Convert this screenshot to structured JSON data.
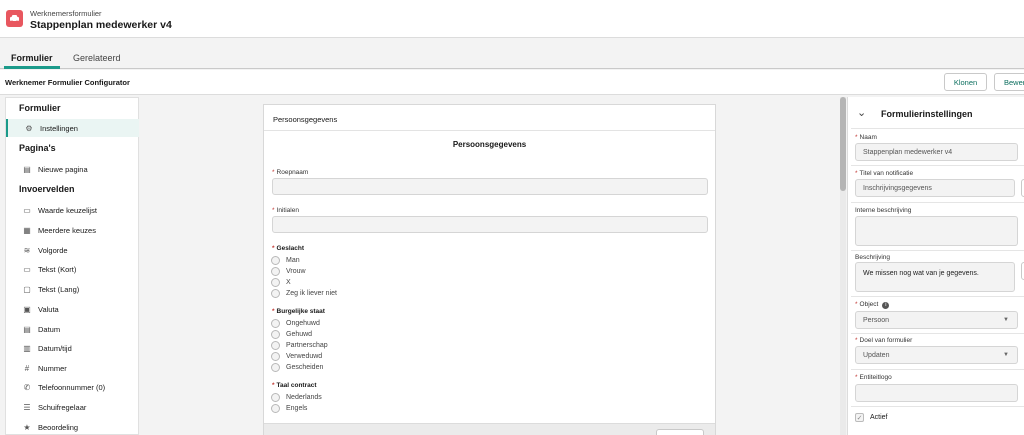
{
  "app": {
    "subtitle": "Werknemersformulier",
    "title": "Stappenplan medewerker v4",
    "icon": "car-icon",
    "accent": "#e8575f"
  },
  "tabs": [
    {
      "label": "Formulier",
      "active": true
    },
    {
      "label": "Gerelateerd",
      "active": false
    }
  ],
  "header": {
    "title": "Werknemer Formulier Configurator",
    "clone_label": "Klonen",
    "edit_label": "Bewer"
  },
  "sidebar": {
    "section_form": "Formulier",
    "item_settings": "Instellingen",
    "section_pages": "Pagina's",
    "item_new_page": "Nieuwe pagina",
    "section_fields": "Invoervelden",
    "fields": [
      {
        "label": "Waarde keuzelijst",
        "icon": "list-icon"
      },
      {
        "label": "Meerdere keuzes",
        "icon": "multi-select-icon"
      },
      {
        "label": "Volgorde",
        "icon": "layers-icon"
      },
      {
        "label": "Tekst (Kort)",
        "icon": "short-text-icon"
      },
      {
        "label": "Tekst (Lang)",
        "icon": "long-text-icon"
      },
      {
        "label": "Valuta",
        "icon": "currency-icon"
      },
      {
        "label": "Datum",
        "icon": "calendar-icon"
      },
      {
        "label": "Datum/tijd",
        "icon": "datetime-icon"
      },
      {
        "label": "Nummer",
        "icon": "number-icon"
      },
      {
        "label": "Telefoonnummer (0)",
        "icon": "phone-icon"
      },
      {
        "label": "Schuifregelaar",
        "icon": "slider-icon"
      },
      {
        "label": "Beoordeling",
        "icon": "star-icon"
      }
    ]
  },
  "form": {
    "card_header": "Persoonsgegevens",
    "title": "Persoonsgegevens",
    "field_roepnaam": "Roepnaam",
    "field_initialen": "Initialen",
    "group_geslacht": "Geslacht",
    "geslacht_options": [
      "Man",
      "Vrouw",
      "X",
      "Zeg ik liever niet"
    ],
    "group_burgerlijke_staat": "Burgelijke staat",
    "burgerlijke_staat_options": [
      "Ongehuwd",
      "Gehuwd",
      "Partnerschap",
      "Verweduwd",
      "Gescheiden"
    ],
    "group_taal": "Taal contract",
    "taal_options": [
      "Nederlands",
      "Engels"
    ]
  },
  "settings": {
    "title": "Formulierinstellingen",
    "naam_label": "Naam",
    "naam_value": "Stappenplan medewerker v4",
    "notificatie_label": "Titel van notificatie",
    "notificatie_value": "Inschrijvingsgegevens",
    "interne_label": "Interne beschrijving",
    "beschrijving_label": "Beschrijving",
    "beschrijving_value": "We missen nog wat van je gegevens.",
    "object_label": "Object",
    "object_value": "Persoon",
    "doel_label": "Doel van formulier",
    "doel_value": "Updaten",
    "logo_label": "Entiteitlogo",
    "actief_label": "Actief"
  }
}
